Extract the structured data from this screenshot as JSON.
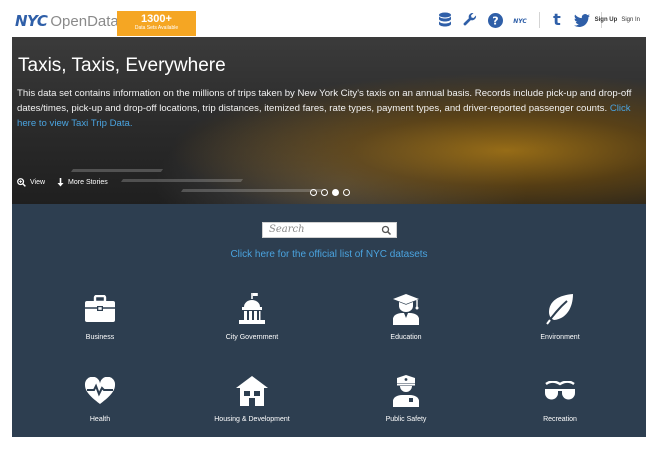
{
  "header": {
    "logo_nyc": "NYC",
    "logo_open": "OpenData",
    "badge_count": "1300+",
    "badge_sub": "Data Sets Available",
    "icons": [
      "database-icon",
      "wrench-icon",
      "help-icon",
      "nyc-icon",
      "tumblr-icon",
      "twitter-icon"
    ],
    "nyc_mini": "NYC",
    "tumblr_glyph": "t",
    "sign_up": "Sign Up",
    "sign_in": "Sign In"
  },
  "hero": {
    "title": "Taxis, Taxis, Everywhere",
    "description": "This data set contains information on the millions of trips taken by New York City's taxis on an annual basis. Records include pick-up and drop-off dates/times, pick-up and drop-off locations, trip distances, itemized fares, rate types, payment types, and driver-reported passenger counts.",
    "link": "Click here to view Taxi Trip Data.",
    "view_label": "View",
    "more_label": "More Stories",
    "slides": 4,
    "active_slide": 3
  },
  "search": {
    "placeholder": "Search"
  },
  "official_link": "Click here for the official list of NYC datasets",
  "categories": [
    {
      "label": "Business",
      "icon": "briefcase-icon"
    },
    {
      "label": "City Government",
      "icon": "government-building-icon"
    },
    {
      "label": "Education",
      "icon": "graduate-icon"
    },
    {
      "label": "Environment",
      "icon": "leaf-icon"
    },
    {
      "label": "Health",
      "icon": "heart-pulse-icon"
    },
    {
      "label": "Housing & Development",
      "icon": "house-icon"
    },
    {
      "label": "Public Safety",
      "icon": "police-officer-icon"
    },
    {
      "label": "Recreation",
      "icon": "sunglasses-icon"
    }
  ],
  "colors": {
    "brand_blue": "#2f5fa8",
    "badge_orange": "#f5a623",
    "link_blue": "#4aa3df",
    "panel_dark": "#2d3e50"
  }
}
